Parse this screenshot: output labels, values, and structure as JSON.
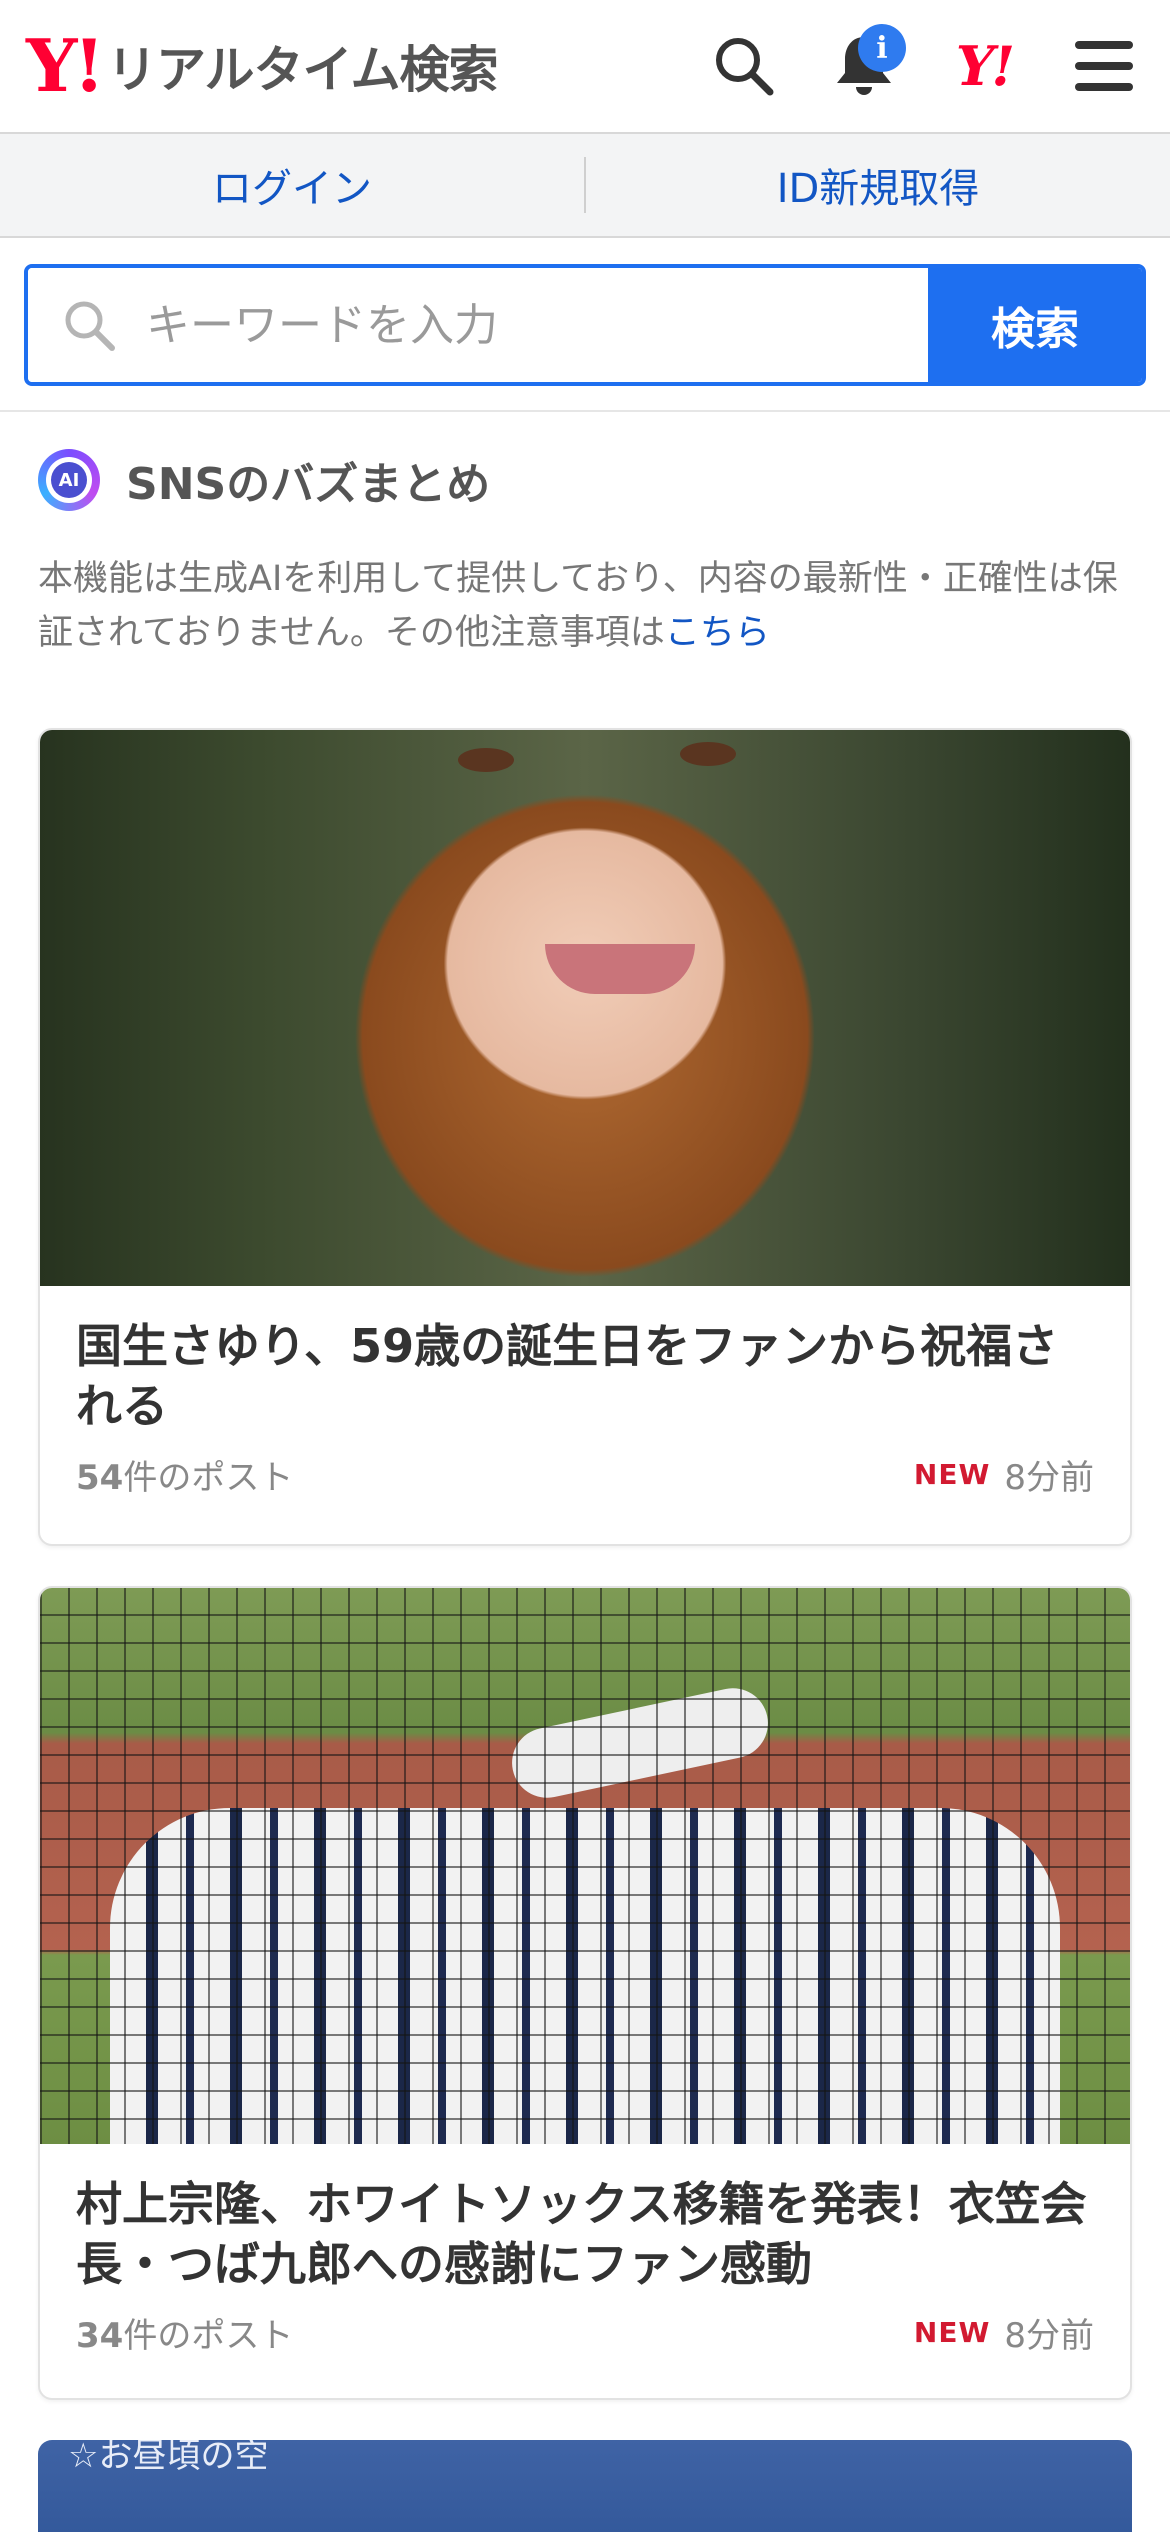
{
  "header": {
    "logo_mark": "Y!",
    "logo_text": "リアルタイム検索",
    "notification_badge": "i",
    "yahoo_icon": "Y!"
  },
  "auth": {
    "login": "ログイン",
    "register": "ID新規取得"
  },
  "search": {
    "placeholder": "キーワードを入力",
    "button": "検索"
  },
  "buzz": {
    "ai_label": "AI",
    "title": "SNSのバズまとめ",
    "disclaimer": "本機能は生成AIを利用して提供しており、内容の最新性・正確性は保証されておりません。その他注意事項は",
    "disclaimer_link": "こちら"
  },
  "cards": [
    {
      "title": "国生さゆり、59歳の誕生日をファンから祝福される",
      "post_count_num": "54",
      "post_count_suffix": "件のポスト",
      "new_label": "NEW",
      "time": "8分前"
    },
    {
      "title": "村上宗隆、ホワイトソックス移籍を発表！衣笠会長・つば九郎への感謝にファン感動",
      "post_count_num": "34",
      "post_count_suffix": "件のポスト",
      "new_label": "NEW",
      "time": "8分前"
    }
  ],
  "partial_card": {
    "peek_text": "☆お昼頃の空"
  },
  "colors": {
    "brand_red": "#ff0033",
    "accent_blue": "#1e6ff0",
    "link_blue": "#1256c4",
    "new_red": "#d21a31"
  },
  "icons": [
    "search-icon",
    "bell-icon",
    "yahoo-icon",
    "menu-icon",
    "ai-icon"
  ]
}
